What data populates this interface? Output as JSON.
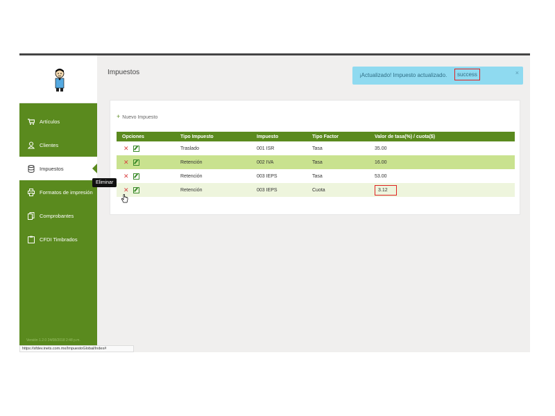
{
  "header": {
    "title": "Impuestos"
  },
  "alert": {
    "message": "¡Actualizado! Impuesto actualizado.",
    "status": "success",
    "close": "×"
  },
  "sidebar": {
    "items": [
      {
        "label": "Artículos",
        "icon": "cart-icon"
      },
      {
        "label": "Clientes",
        "icon": "user-icon"
      },
      {
        "label": "Impuestos",
        "icon": "database-icon",
        "active": true
      },
      {
        "label": "Formatos de impresión",
        "icon": "printer-icon"
      },
      {
        "label": "Comprobantes",
        "icon": "documents-icon"
      },
      {
        "label": "CFDI Timbrados",
        "icon": "clipboard-icon"
      }
    ],
    "version": "Versión 1.2.0 24/08/2018 2:48 p.m."
  },
  "toolbar": {
    "new_label": "Nuevo Impuesto"
  },
  "table": {
    "headers": [
      "Opciones",
      "Tipo Impuesto",
      "Impuesto",
      "Tipo Factor",
      "Valor de tasa(%) / cuota($)"
    ],
    "rows": [
      {
        "tipo": "Traslado",
        "impuesto": "001 ISR",
        "factor": "Tasa",
        "valor": "35.00"
      },
      {
        "tipo": "Retención",
        "impuesto": "002 IVA",
        "factor": "Tasa",
        "valor": "16.00"
      },
      {
        "tipo": "Retención",
        "impuesto": "003 IEPS",
        "factor": "Tasa",
        "valor": "53.00"
      },
      {
        "tipo": "Retención",
        "impuesto": "003 IEPS",
        "factor": "Cuota",
        "valor": "3.12"
      }
    ]
  },
  "tooltip": "Eliminar",
  "statusbar": {
    "url": "https://sfdev.inets.com.mx/ImpuestoGlobal/Index#"
  },
  "colors": {
    "sidebar": "#5a8a1e",
    "alert_bg": "#8fdaf0",
    "highlight": "#e02020",
    "row_alt": "#c9e28f"
  }
}
